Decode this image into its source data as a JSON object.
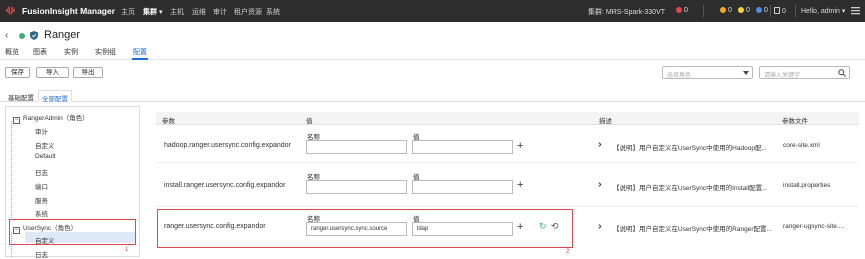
{
  "topbar": {
    "brand": "FusionInsight Manager",
    "nav": [
      "主页",
      "集群",
      "主机",
      "运维",
      "审计",
      "租户资源",
      "系统"
    ],
    "active_nav_caret": "▾",
    "cluster_label": "集群: MRS-Spark-330VT",
    "alarm_critical": "0",
    "alarm_major": "0",
    "alarm_minor": "0",
    "alarm_warning": "0",
    "tasks": "0",
    "user": "Hello, admin ▾",
    "colors": {
      "critical": "#e0474c",
      "major": "#f5a623",
      "minor": "#f5d623",
      "warning": "#4a90e2"
    }
  },
  "service": {
    "back_icon": "‹",
    "name": "Ranger"
  },
  "tabs": [
    "概览",
    "图表",
    "实例",
    "实例组",
    "配置"
  ],
  "toolbar": {
    "save": "保存",
    "import": "导入",
    "export": "导出"
  },
  "filters": {
    "role_placeholder": "选择角色",
    "search_placeholder": "请输入关键字"
  },
  "subtabs": [
    "基础配置",
    "全部配置"
  ],
  "tree": {
    "group1": "RangerAdmin（角色）",
    "group1_items": [
      "审计",
      "自定义",
      "Default",
      "日志",
      "端口",
      "服务",
      "系统"
    ],
    "group2": "UserSync（角色）",
    "group2_items": [
      "自定义",
      "日志"
    ]
  },
  "table": {
    "headers": {
      "param": "参数",
      "value": "值",
      "desc": "描述",
      "file": "参数文件"
    },
    "sub_name": "名称",
    "sub_value": "值",
    "rows": [
      {
        "param": "hadoop.ranger.usersync.config.expandor",
        "name": "",
        "value": "",
        "desc": "【说明】用户自定义在UserSync中使用的Hadoop配...",
        "file": "core-site.xml"
      },
      {
        "param": "install.ranger.usersync.config.expandor",
        "name": "",
        "value": "",
        "desc": "【说明】用户自定义在UserSync中使用的Install配置...",
        "file": "install.properties"
      },
      {
        "param": "ranger.usersync.config.expandor",
        "name": "ranger.usersync.sync.source",
        "value": "ldap",
        "desc": "【说明】用户自定义在UserSync中使用的Ranger配置...",
        "file": "ranger-ugsync-site...."
      }
    ]
  },
  "annotations": {
    "one": "1",
    "two": "2"
  }
}
